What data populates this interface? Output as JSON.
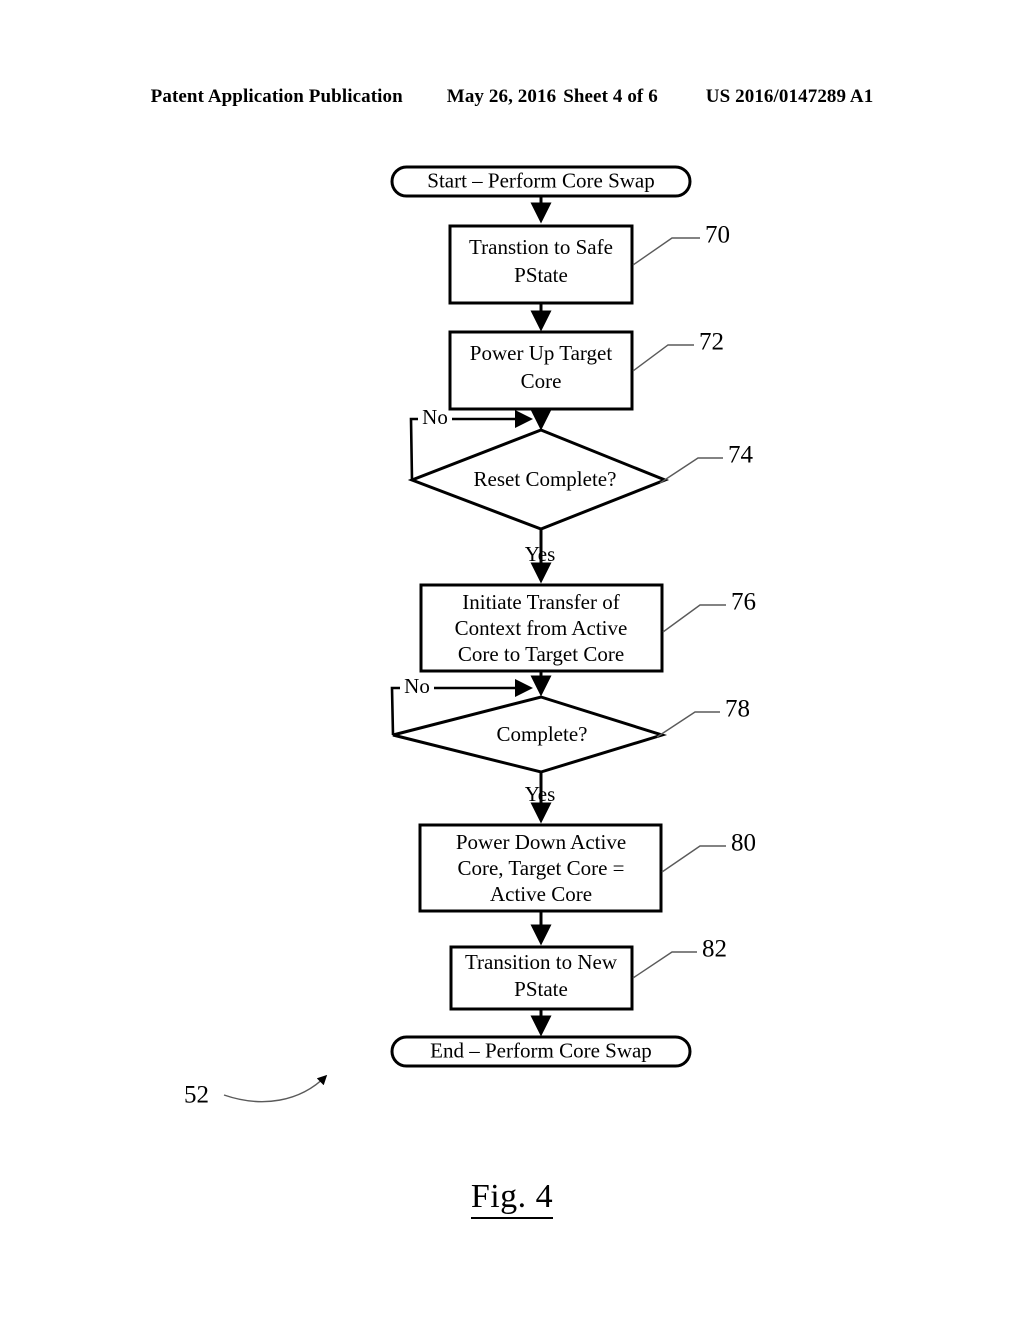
{
  "header": {
    "publication": "Patent Application Publication",
    "date": "May 26, 2016",
    "sheet": "Sheet 4 of 6",
    "patent_number": "US 2016/0147289 A1"
  },
  "figure": {
    "caption": "Fig. 4",
    "diagram_reference": "52"
  },
  "flowchart": {
    "title": "Perform Core Swap",
    "nodes": [
      {
        "id": "start",
        "type": "terminal",
        "label": "Start – Perform Core Swap",
        "ref": ""
      },
      {
        "id": "n70",
        "type": "process",
        "label": "Transtion to Safe\nPState",
        "ref": "70"
      },
      {
        "id": "n72",
        "type": "process",
        "label": "Power Up Target\nCore",
        "ref": "72"
      },
      {
        "id": "n74",
        "type": "decision",
        "label": "Reset Complete?",
        "ref": "74"
      },
      {
        "id": "n76",
        "type": "process",
        "label": "Initiate Transfer of\nContext from Active\nCore to Target Core",
        "ref": "76"
      },
      {
        "id": "n78",
        "type": "decision",
        "label": "Complete?",
        "ref": "78"
      },
      {
        "id": "n80",
        "type": "process",
        "label": "Power Down Active\nCore, Target Core =\nActive Core",
        "ref": "80"
      },
      {
        "id": "n82",
        "type": "process",
        "label": "Transition to New\nPState",
        "ref": "82"
      },
      {
        "id": "end",
        "type": "terminal",
        "label": "End – Perform Core Swap",
        "ref": ""
      }
    ],
    "node_text": {
      "start": "Start – Perform Core Swap",
      "n70_l1": "Transtion to Safe",
      "n70_l2": "PState",
      "n72_l1": "Power Up Target",
      "n72_l2": "Core",
      "n74": "Reset Complete?",
      "n76_l1": "Initiate Transfer of",
      "n76_l2": "Context from Active",
      "n76_l3": "Core to Target Core",
      "n78": "Complete?",
      "n80_l1": "Power Down Active",
      "n80_l2": "Core, Target Core =",
      "n80_l3": "Active Core",
      "n82_l1": "Transition to New",
      "n82_l2": "PState",
      "end": "End – Perform Core Swap"
    },
    "refs": {
      "r70": "70",
      "r72": "72",
      "r74": "74",
      "r76": "76",
      "r78": "78",
      "r80": "80",
      "r82": "82",
      "r52": "52"
    },
    "edge_labels": {
      "no_74": "No",
      "yes_74": "Yes",
      "no_78": "No",
      "yes_78": "Yes"
    },
    "edges": [
      {
        "from": "start",
        "to": "n70",
        "label": ""
      },
      {
        "from": "n70",
        "to": "n72",
        "label": ""
      },
      {
        "from": "n72",
        "to": "n74",
        "label": ""
      },
      {
        "from": "n74",
        "to": "n74",
        "label": "No"
      },
      {
        "from": "n74",
        "to": "n76",
        "label": "Yes"
      },
      {
        "from": "n76",
        "to": "n78",
        "label": ""
      },
      {
        "from": "n78",
        "to": "n78",
        "label": "No"
      },
      {
        "from": "n78",
        "to": "n80",
        "label": "Yes"
      },
      {
        "from": "n80",
        "to": "n82",
        "label": ""
      },
      {
        "from": "n82",
        "to": "end",
        "label": ""
      }
    ]
  },
  "colors": {
    "background": "#ffffff",
    "ink": "#000000",
    "leader": "#5a5a5a"
  }
}
